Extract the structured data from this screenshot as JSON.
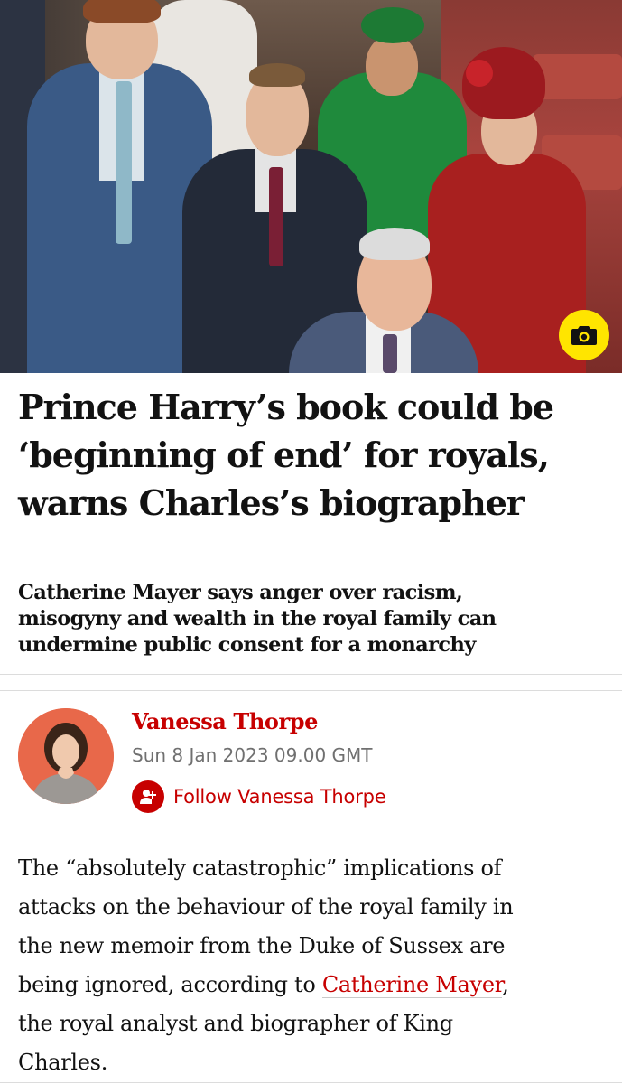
{
  "article": {
    "headline_line1": "Prince Harry’s book could be",
    "headline_line2": "‘beginning of end’ for royals,",
    "headline_line3": "warns Charles’s biographer",
    "standfirst_line1": "Catherine Mayer says anger over racism,",
    "standfirst_line2": "misogyny and wealth in the royal family can",
    "standfirst_line3": "undermine public consent for a monarchy"
  },
  "byline": {
    "author": "Vanessa Thorpe",
    "date": "Sun 8 Jan 2023 09.00 GMT",
    "follow_label": "Follow Vanessa Thorpe"
  },
  "body": {
    "line1": "The “absolutely catastrophic” implications of",
    "line2": "attacks on the behaviour of the royal family in",
    "line3": "the new memoir from the Duke of Sussex are",
    "line4_prefix": "being ignored, according to ",
    "line4_link": "Catherine Mayer",
    "line4_suffix": ",",
    "line5": "the royal analyst and biographer of King",
    "line6": "Charles."
  },
  "icons": {
    "gallery": "camera-icon",
    "follow": "add-person-icon"
  },
  "colors": {
    "accent_red": "#c70000",
    "camera_button": "#ffe500",
    "text": "#121212",
    "meta_grey": "#707070"
  }
}
